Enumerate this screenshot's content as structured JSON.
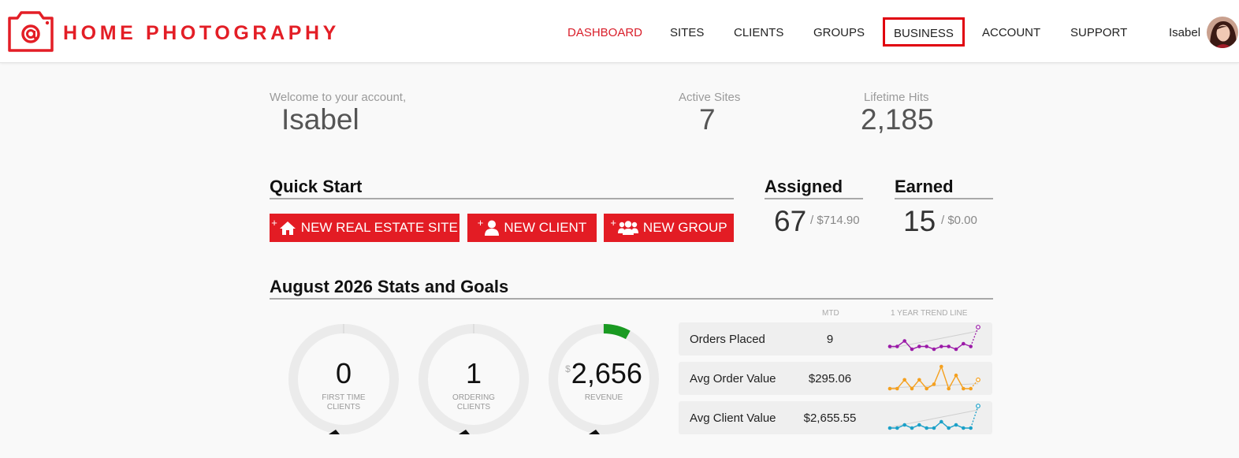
{
  "header": {
    "brand": "HOME PHOTOGRAPHY",
    "nav": [
      "DASHBOARD",
      "SITES",
      "CLIENTS",
      "GROUPS",
      "BUSINESS",
      "ACCOUNT",
      "SUPPORT"
    ],
    "user_name": "Isabel"
  },
  "welcome": {
    "label": "Welcome to your account,",
    "name": "Isabel"
  },
  "summary": {
    "active_sites_label": "Active Sites",
    "active_sites": "7",
    "lifetime_hits_label": "Lifetime Hits",
    "lifetime_hits": "2,185"
  },
  "quick_start": {
    "title": "Quick Start",
    "plus": "+",
    "buttons": [
      "NEW REAL ESTATE SITE",
      "NEW CLIENT",
      "NEW GROUP"
    ]
  },
  "assigned": {
    "title": "Assigned",
    "count": "67",
    "amount": "/ $714.90"
  },
  "earned": {
    "title": "Earned",
    "count": "15",
    "amount": "/ $0.00"
  },
  "stats": {
    "title": "August 2026 Stats and Goals",
    "gauges": [
      {
        "value": "0",
        "label_line1": "FIRST TIME",
        "label_line2": "CLIENTS",
        "progress": 0
      },
      {
        "value": "1",
        "label_line1": "ORDERING",
        "label_line2": "CLIENTS",
        "progress": 0
      },
      {
        "currency": "$",
        "value": "2,656",
        "label_line1": "REVENUE",
        "label_line2": "",
        "progress": 0.08
      }
    ],
    "col_mtd": "MTD",
    "col_trend": "1 YEAR TREND LINE",
    "rows": [
      {
        "label": "Orders Placed",
        "value": "9",
        "color": "#9b1aa8",
        "trend": [
          1,
          1,
          3,
          0,
          1,
          1,
          0,
          1,
          1,
          0,
          2,
          1,
          8
        ]
      },
      {
        "label": "Avg Order Value",
        "value": "$295.06",
        "color": "#f5a01e",
        "trend": [
          1,
          1,
          3,
          1,
          3,
          1,
          2,
          6,
          1,
          4,
          1,
          1,
          3
        ]
      },
      {
        "label": "Avg Client Value",
        "value": "$2,655.55",
        "color": "#1aa0c8",
        "trend": [
          1,
          1,
          2,
          1,
          2,
          1,
          1,
          3,
          1,
          2,
          1,
          1,
          8
        ]
      }
    ]
  },
  "colors": {
    "brand_red": "#e31e26",
    "gauge_progress": "#1a9a22",
    "gauge_track": "#ebebeb"
  }
}
